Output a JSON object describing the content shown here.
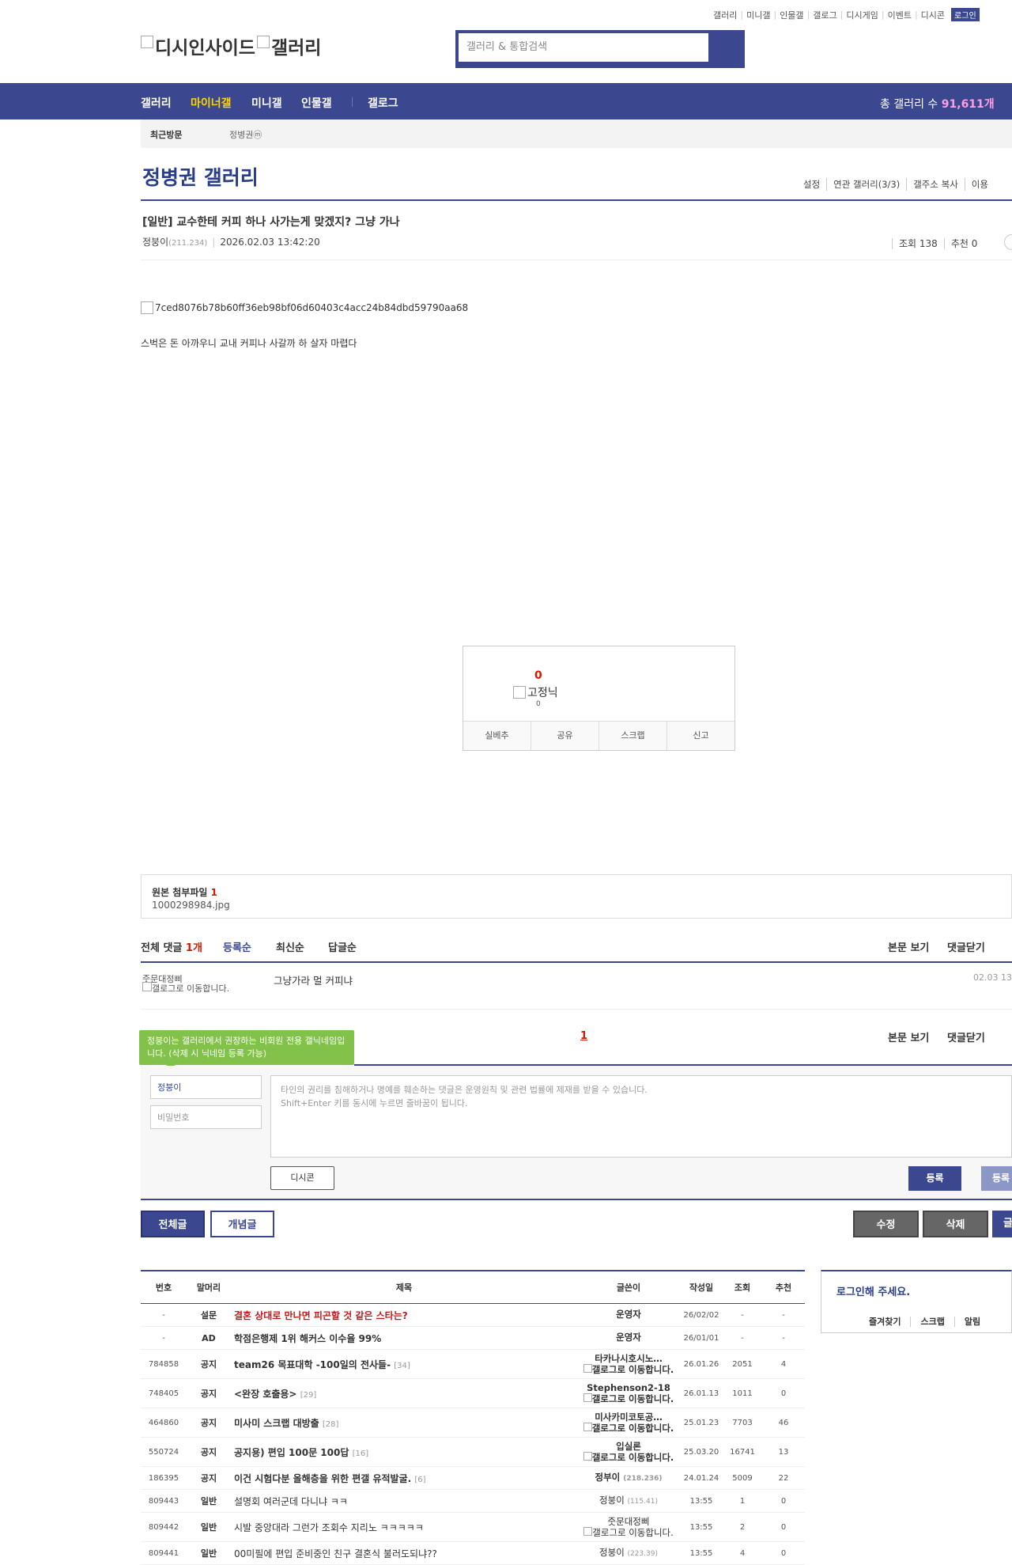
{
  "top_links": [
    "갤러리",
    "미니갤",
    "인물갤",
    "갤로그",
    "디시게임",
    "이벤트",
    "디시콘"
  ],
  "login_label": "로그인",
  "logo": {
    "part1": "디시인사이드",
    "part2": "갤러리"
  },
  "search": {
    "placeholder": "갤러리 & 통합검색"
  },
  "nav": {
    "items": [
      "갤러리",
      "마이너갤",
      "미니갤",
      "인물갤",
      "갤로그"
    ],
    "total_label": "총 갤러리 수",
    "total_value": "91,611개"
  },
  "recent": {
    "label": "최근방문",
    "gallery": "정병권ⓜ"
  },
  "gallery": {
    "title": "정병권 갤러리",
    "links": [
      "설정",
      "연관 갤러리(3/3)",
      "갤주소 복사",
      "이용"
    ]
  },
  "post": {
    "title": "[일반] 교수한테 커피 하나 사가는게 맞겠지? 그냥 가나",
    "author": "정붕이",
    "ip": "(211.234)",
    "date": "2026.02.03 13:42:20",
    "views": "조회 138",
    "recommend": "추천 0",
    "image_alt": "7ced8076b78b60ff36eb98bf06d60403c4acc24b84dbd59790aa68",
    "body": "스벅은 돈 아까우니 교내 커피나 사갈까 하 살자 마렵다"
  },
  "recommend_box": {
    "count": "0",
    "fixed_label": "고정닉",
    "fixed_count": "0",
    "buttons": [
      "실베추",
      "공유",
      "스크랩",
      "신고"
    ]
  },
  "attachment": {
    "label": "원본 첨부파일",
    "count": "1",
    "file": "1000298984.jpg"
  },
  "comments": {
    "total_label": "전체 댓글",
    "total_count": "1개",
    "sort": [
      "등록순",
      "최신순",
      "답글순"
    ],
    "right_links": [
      "본문 보기",
      "댓글닫기"
    ],
    "items": [
      {
        "nick": "줏문대정삐",
        "img_alt": "갤로그로 이동합니다.",
        "text": "그냥가라 멀 커피냐",
        "date": "02.03 13"
      }
    ],
    "page": "1"
  },
  "write": {
    "tip": "정붕이는 갤러리에서 권장하는 비회원 전용 갤닉네임입니다. (삭제 시 닉네임 등록 가능)",
    "nick": "정붕이",
    "password_placeholder": "비밀번호",
    "memo_line1": "타인의 권리를 침해하거나 명예를 훼손하는 댓글은 운영원칙 및 관련 법률에 제재를 받을 수 있습니다.",
    "memo_line2": "Shift+Enter 키를 동시에 누르면 줄바꿈이 됩니다.",
    "dccon": "디시콘",
    "submit1": "등록",
    "submit2": "등록"
  },
  "bottom_buttons": {
    "all": "전체글",
    "concept": "개념글",
    "edit": "수정",
    "delete": "삭제",
    "write": "글"
  },
  "list": {
    "headers": [
      "번호",
      "말머리",
      "제목",
      "글쓴이",
      "작성일",
      "조회",
      "추천"
    ],
    "rows": [
      {
        "num": "-",
        "head": "설문",
        "subject": "결혼 상대로 만나면 피곤할 것 같은 스타는?",
        "reply": "",
        "writer": "운영자",
        "writer2": "",
        "date": "26/02/02",
        "views": "-",
        "rec": "-"
      },
      {
        "num": "-",
        "head": "AD",
        "subject": "학점은행제 1위 해커스 이수율 99%",
        "reply": "",
        "writer": "운영자",
        "writer2": "",
        "date": "26/01/01",
        "views": "-",
        "rec": "-"
      },
      {
        "num": "784858",
        "head": "공지",
        "subject": "team26 목표대학 -100일의 전사들-",
        "reply": "[34]",
        "writer": "타카나시호시노…",
        "writer2": "갤로그로 이동합니다.",
        "date": "26.01.26",
        "views": "2051",
        "rec": "4"
      },
      {
        "num": "748405",
        "head": "공지",
        "subject": "<완장 호출용>",
        "reply": "[29]",
        "writer": "Stephenson2-18",
        "writer2": "갤로그로 이동합니다.",
        "date": "26.01.13",
        "views": "1011",
        "rec": "0"
      },
      {
        "num": "464860",
        "head": "공지",
        "subject": "미사미 스크랩 대방출",
        "reply": "[28]",
        "writer": "미사카미코토공…",
        "writer2": "갤로그로 이동합니다.",
        "date": "25.01.23",
        "views": "7703",
        "rec": "46"
      },
      {
        "num": "550724",
        "head": "공지",
        "subject": "공지용) 편입 100문 100답",
        "reply": "[16]",
        "writer": "입실론",
        "writer2": "갤로그로 이동합니다.",
        "date": "25.03.20",
        "views": "16741",
        "rec": "13"
      },
      {
        "num": "186395",
        "head": "공지",
        "subject": "이건 시험다분 올해층을 위한 편갤 유적발굴.",
        "reply": "[6]",
        "writer": "정부이",
        "writer2": "(218.236)",
        "date": "24.01.24",
        "views": "5009",
        "rec": "22"
      },
      {
        "num": "809443",
        "head": "일반",
        "subject": "설명회 여러군데 다니냐 ㅋㅋ",
        "reply": "",
        "writer": "정붕이",
        "writer2": "(115.41)",
        "date": "13:55",
        "views": "1",
        "rec": "0"
      },
      {
        "num": "809442",
        "head": "일반",
        "subject": "시발 중앙대라 그런가 조회수 지리노 ㅋㅋㅋㅋㅋ",
        "reply": "",
        "writer": "줏문대정삐",
        "writer2": "갤로그로 이동합니다.",
        "date": "13:55",
        "views": "2",
        "rec": "0"
      },
      {
        "num": "809441",
        "head": "일반",
        "subject": "00미필에 편입 준비중인 친구 결혼식 불러도되냐??",
        "reply": "",
        "writer": "정붕이",
        "writer2": "(223.39)",
        "date": "13:55",
        "views": "4",
        "rec": "0"
      }
    ]
  },
  "login_box": {
    "title": "로그인해 주세요.",
    "links": [
      "즐겨찾기",
      "스크랩",
      "알림"
    ]
  },
  "colors": {
    "brand": "#3b4890",
    "accent_red": "#d31900",
    "tip_green": "#82c14a"
  }
}
